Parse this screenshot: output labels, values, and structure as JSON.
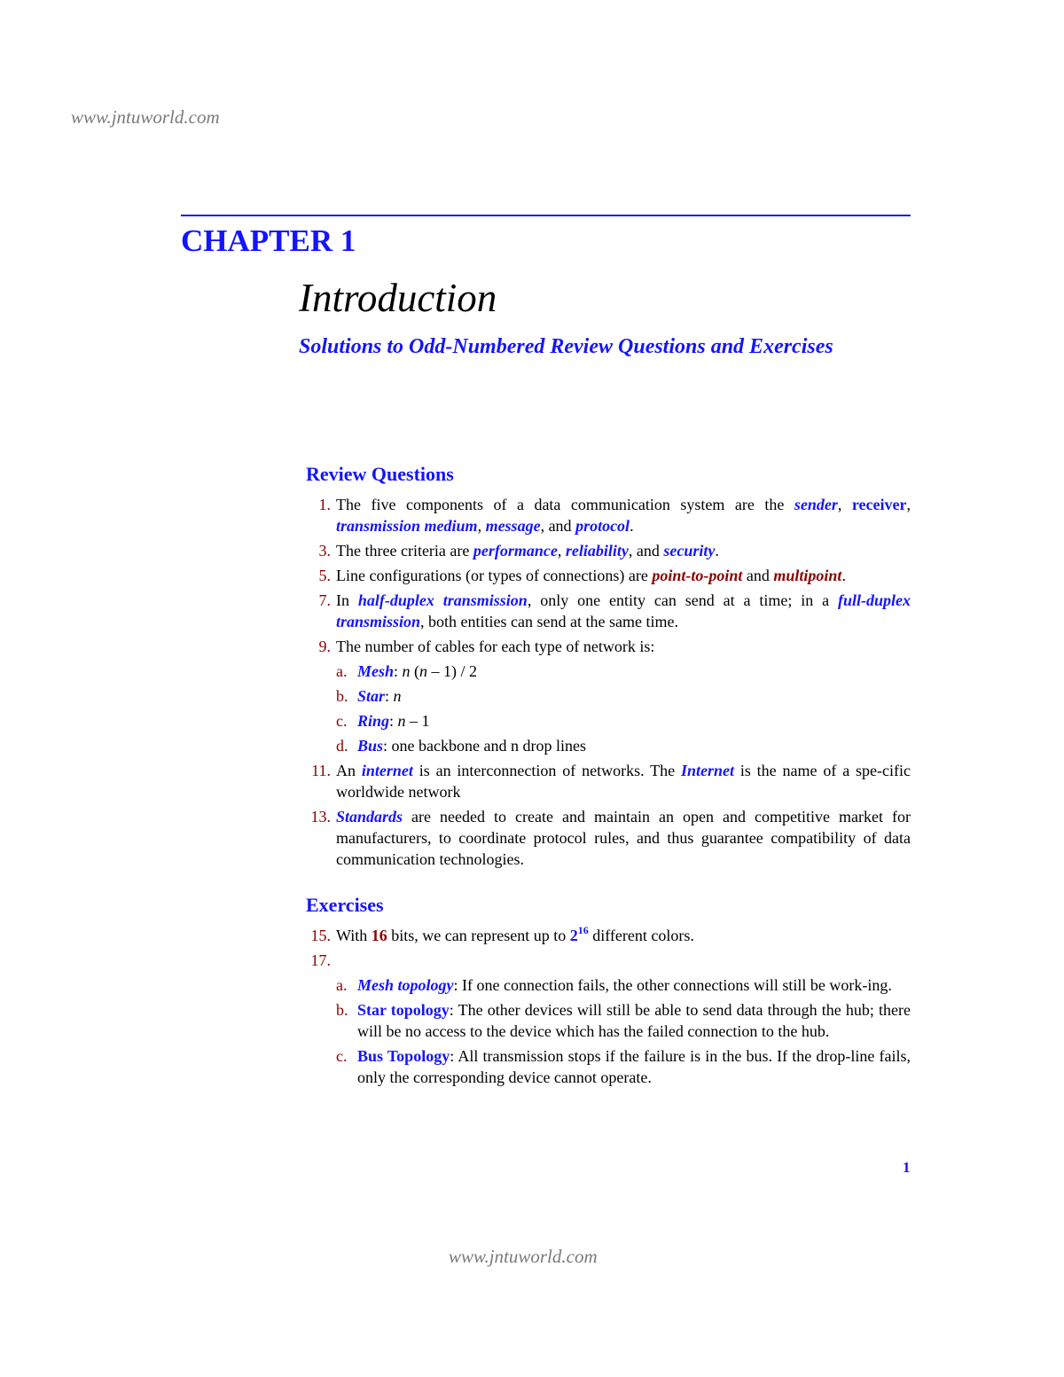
{
  "watermark_top": "www.jntuworld.com",
  "watermark_bottom": "www.jntuworld.com",
  "chapter": "CHAPTER 1",
  "title": "Introduction",
  "subtitle": "Solutions to Odd-Numbered Review Questions and Exercises",
  "page_number": "1",
  "colors": {
    "accent_blue": "#1414ff",
    "number_red": "#8b0000",
    "watermark_gray": "#7a7a7a"
  },
  "review": {
    "heading": "Review Questions",
    "items": [
      {
        "num": "1.",
        "segments": [
          {
            "t": "The five components of a data communication system are the ",
            "s": ""
          },
          {
            "t": "sender",
            "s": "bi"
          },
          {
            "t": ", ",
            "s": ""
          },
          {
            "t": "receiver",
            "s": "b"
          },
          {
            "t": ", ",
            "s": ""
          },
          {
            "t": "transmission medium",
            "s": "bi"
          },
          {
            "t": ", ",
            "s": ""
          },
          {
            "t": "message",
            "s": "bi"
          },
          {
            "t": ", and ",
            "s": ""
          },
          {
            "t": "protocol",
            "s": "bi"
          },
          {
            "t": ".",
            "s": ""
          }
        ]
      },
      {
        "num": "3.",
        "segments": [
          {
            "t": "The three criteria are ",
            "s": ""
          },
          {
            "t": "performance",
            "s": "bi"
          },
          {
            "t": ", ",
            "s": ""
          },
          {
            "t": "reliability",
            "s": "bi"
          },
          {
            "t": ", and ",
            "s": ""
          },
          {
            "t": "security",
            "s": "bi"
          },
          {
            "t": ".",
            "s": ""
          }
        ]
      },
      {
        "num": "5.",
        "segments": [
          {
            "t": "Line configurations (or types of connections) are ",
            "s": ""
          },
          {
            "t": "point-to-point",
            "s": "ri"
          },
          {
            "t": " and ",
            "s": ""
          },
          {
            "t": "multipoint",
            "s": "ri"
          },
          {
            "t": ".",
            "s": ""
          }
        ]
      },
      {
        "num": "7.",
        "segments": [
          {
            "t": "In ",
            "s": ""
          },
          {
            "t": "half-duplex transmission",
            "s": "bi"
          },
          {
            "t": ", only one entity can send at a time; in a ",
            "s": ""
          },
          {
            "t": "full-duplex transmission",
            "s": "bi"
          },
          {
            "t": ", both entities can send at the same time.",
            "s": ""
          }
        ]
      },
      {
        "num": "9.",
        "segments": [
          {
            "t": "The number of cables for each type of network is:",
            "s": ""
          }
        ],
        "sub": [
          {
            "num": "a.",
            "segments": [
              {
                "t": "Mesh",
                "s": "bi"
              },
              {
                "t": ": ",
                "s": ""
              },
              {
                "t": "n",
                "s": "i"
              },
              {
                "t": " (",
                "s": ""
              },
              {
                "t": "n",
                "s": "i"
              },
              {
                "t": " – 1) / 2",
                "s": ""
              }
            ]
          },
          {
            "num": "b.",
            "segments": [
              {
                "t": "Star",
                "s": "bi"
              },
              {
                "t": ": ",
                "s": ""
              },
              {
                "t": "n",
                "s": "i"
              }
            ]
          },
          {
            "num": "c.",
            "segments": [
              {
                "t": "Ring",
                "s": "bi"
              },
              {
                "t": ": ",
                "s": ""
              },
              {
                "t": "n",
                "s": "i"
              },
              {
                "t": " – 1",
                "s": ""
              }
            ]
          },
          {
            "num": "d.",
            "segments": [
              {
                "t": "Bus",
                "s": "bi"
              },
              {
                "t": ": one backbone and n drop lines",
                "s": ""
              }
            ]
          }
        ]
      },
      {
        "num": "11.",
        "segments": [
          {
            "t": "An ",
            "s": ""
          },
          {
            "t": "internet",
            "s": "bi"
          },
          {
            "t": " is an interconnection of networks. The ",
            "s": ""
          },
          {
            "t": "Internet",
            "s": "bi"
          },
          {
            "t": " is the name of a spe-cific worldwide network",
            "s": ""
          }
        ]
      },
      {
        "num": "13.",
        "segments": [
          {
            "t": "Standards",
            "s": "bi"
          },
          {
            "t": " are needed to create and maintain an open and competitive market for manufacturers, to coordinate protocol rules, and thus guarantee compatibility of data communication technologies.",
            "s": ""
          }
        ]
      }
    ]
  },
  "exercises": {
    "heading": "Exercises",
    "items": [
      {
        "num": "15.",
        "segments": [
          {
            "t": "With ",
            "s": ""
          },
          {
            "t": "16",
            "s": "rb"
          },
          {
            "t": " bits, we can represent up to ",
            "s": ""
          },
          {
            "t": "2",
            "s": "b"
          },
          {
            "t": "16",
            "s": "sup"
          },
          {
            "t": " different colors.",
            "s": ""
          }
        ]
      },
      {
        "num": "17.",
        "segments": [],
        "sub": [
          {
            "num": "a.",
            "segments": [
              {
                "t": "Mesh topology",
                "s": "bi"
              },
              {
                "t": ": If one connection fails, the other connections will still be work-ing.",
                "s": ""
              }
            ]
          },
          {
            "num": "b.",
            "segments": [
              {
                "t": "Star topology",
                "s": "b"
              },
              {
                "t": ": The other devices will still be able to send data through the hub; there will be no access to the device which has the failed connection to the hub.",
                "s": ""
              }
            ]
          },
          {
            "num": "c.",
            "segments": [
              {
                "t": "Bus Topology",
                "s": "b"
              },
              {
                "t": ": All transmission stops if the failure is in the bus. If the drop-line fails, only the corresponding device cannot operate.",
                "s": ""
              }
            ]
          }
        ]
      }
    ]
  }
}
